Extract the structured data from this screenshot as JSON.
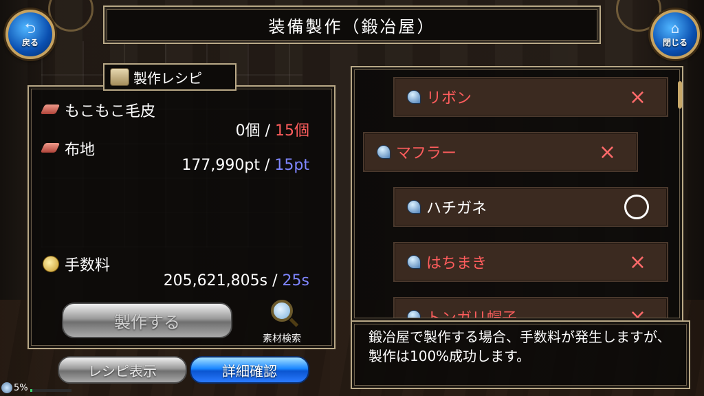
{
  "header": {
    "title": "装備製作（鍛冶屋）"
  },
  "nav": {
    "back_label": "戻る",
    "close_label": "閉じる",
    "back_icon": "return-arrow-icon",
    "close_icon": "home-icon"
  },
  "recipe": {
    "title": "製作レシピ",
    "materials": [
      {
        "name": "もこもこ毛皮",
        "have": "0個",
        "sep": "/",
        "need": "15個"
      },
      {
        "name": "布地",
        "have": "177,990pt",
        "sep": "/",
        "need": "15pt"
      }
    ],
    "fee": {
      "label": "手数料",
      "have": "205,621,805s",
      "sep": "/",
      "need": "25s"
    },
    "craft_label": "製作する",
    "search_label": "素材検索"
  },
  "buttons": {
    "recipe_display": "レシピ表示",
    "detail_confirm": "詳細確認"
  },
  "items": [
    {
      "name": "リボン",
      "mark": "×"
    },
    {
      "name": "マフラー",
      "mark": "×"
    },
    {
      "name": "ハチガネ",
      "mark": "○"
    },
    {
      "name": "はちまき",
      "mark": "×"
    },
    {
      "name": "トンガリ帽子",
      "mark": "×"
    }
  ],
  "message": "鍛冶屋で製作する場合、手数料が発生しますが、製作は100%成功します。",
  "status": {
    "percent": "5%",
    "gauge_fraction": 0.05
  },
  "colors": {
    "insufficient": "#ff5d5d",
    "sufficient_need": "#7f86ff",
    "frame": "#b9a987"
  }
}
